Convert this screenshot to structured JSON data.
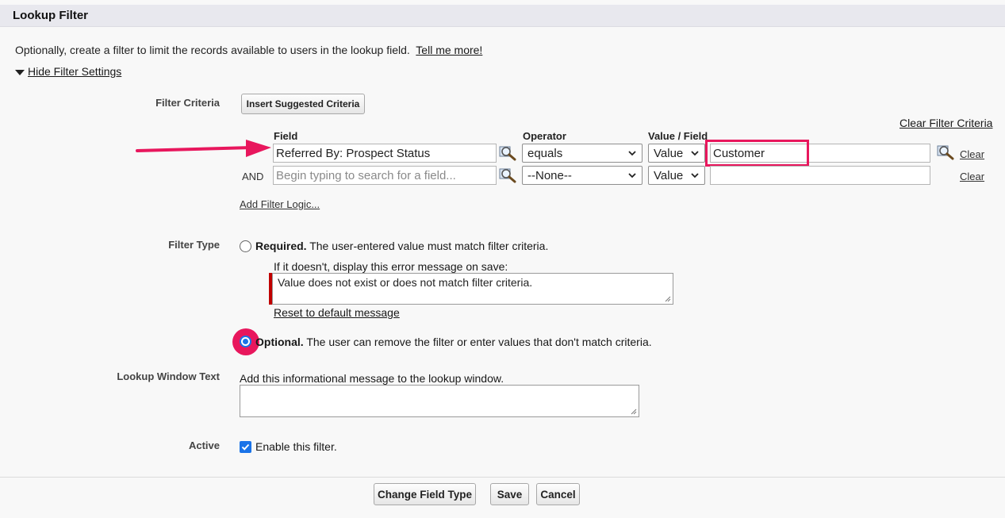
{
  "section": {
    "title": "Lookup Filter"
  },
  "intro": {
    "text": "Optionally, create a filter to limit the records available to users in the lookup field.",
    "link": "Tell me more!"
  },
  "hide_settings_link": "Hide Filter Settings",
  "criteria": {
    "label": "Filter Criteria",
    "suggest_button": "Insert Suggested Criteria",
    "clear_all_link": "Clear Filter Criteria",
    "headers": {
      "field": "Field",
      "operator": "Operator",
      "value": "Value / Field"
    },
    "rows": [
      {
        "prefix": "",
        "field_value": "Referred By: Prospect Status",
        "field_placeholder": "",
        "operator": "equals",
        "value_type": "Value",
        "value": "Customer",
        "clear": "Clear"
      },
      {
        "prefix": "AND",
        "field_value": "",
        "field_placeholder": "Begin typing to search for a field...",
        "operator": "--None--",
        "value_type": "Value",
        "value": "",
        "clear": "Clear"
      }
    ],
    "add_logic_link": "Add Filter Logic..."
  },
  "filter_type": {
    "label": "Filter Type",
    "required": {
      "title": "Required.",
      "desc": "The user-entered value must match filter criteria.",
      "selected": false
    },
    "error_prompt": "If it doesn't, display this error message on save:",
    "error_message": "Value does not exist or does not match filter criteria.",
    "reset_link": "Reset to default message",
    "optional": {
      "title": "Optional.",
      "desc": "The user can remove the filter or enter values that don't match criteria.",
      "selected": true
    }
  },
  "lookup_window": {
    "label": "Lookup Window Text",
    "prompt": "Add this informational message to the lookup window.",
    "value": ""
  },
  "active": {
    "label": "Active",
    "checkbox_label": "Enable this filter.",
    "checked": true
  },
  "footer": {
    "change_type": "Change Field Type",
    "save": "Save",
    "cancel": "Cancel"
  },
  "colors": {
    "highlight": "#e8175d",
    "accent": "#1a73e8",
    "required_bar": "#c00000"
  },
  "icons": {
    "lookup": "magnifier-icon",
    "arrow": "annotation-arrow",
    "triangle": "triangle-down-icon"
  }
}
